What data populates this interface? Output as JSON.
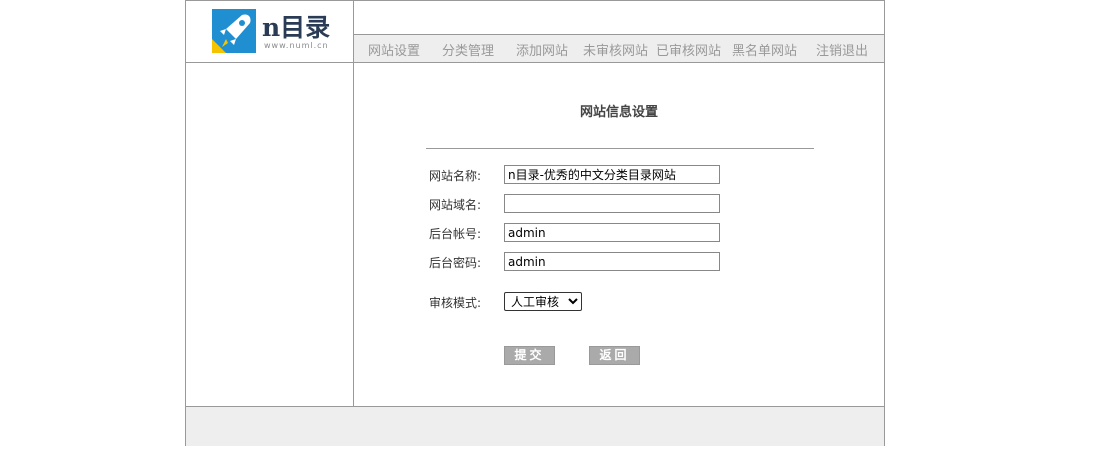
{
  "brand": {
    "name": "n目录",
    "url": "www.numl.cn",
    "logo_icon": "rocket-icon",
    "logo_colors": {
      "primary": "#1f8fd1",
      "accent": "#f5c400",
      "dark": "#2a3c55"
    }
  },
  "nav": {
    "items": [
      {
        "label": "网站设置"
      },
      {
        "label": "分类管理"
      },
      {
        "label": "添加网站"
      },
      {
        "label": "未审核网站"
      },
      {
        "label": "已审核网站"
      },
      {
        "label": "黑名单网站"
      },
      {
        "label": "注销退出"
      }
    ]
  },
  "page": {
    "title": "网站信息设置"
  },
  "form": {
    "site_name": {
      "label": "网站名称:",
      "value": "n目录-优秀的中文分类目录网站"
    },
    "site_domain": {
      "label": "网站域名:",
      "value": ""
    },
    "admin_account": {
      "label": "后台帐号:",
      "value": "admin"
    },
    "admin_password": {
      "label": "后台密码:",
      "value": "admin"
    },
    "review_mode": {
      "label": "审核模式:",
      "selected": "人工审核"
    }
  },
  "buttons": {
    "submit": "提交",
    "back": "返回"
  },
  "colors": {
    "border": "#999999",
    "nav_bg": "#eeeeee",
    "nav_text": "#999999",
    "button_bg": "#aaaaaa",
    "footer_bg": "#eeeeee"
  }
}
